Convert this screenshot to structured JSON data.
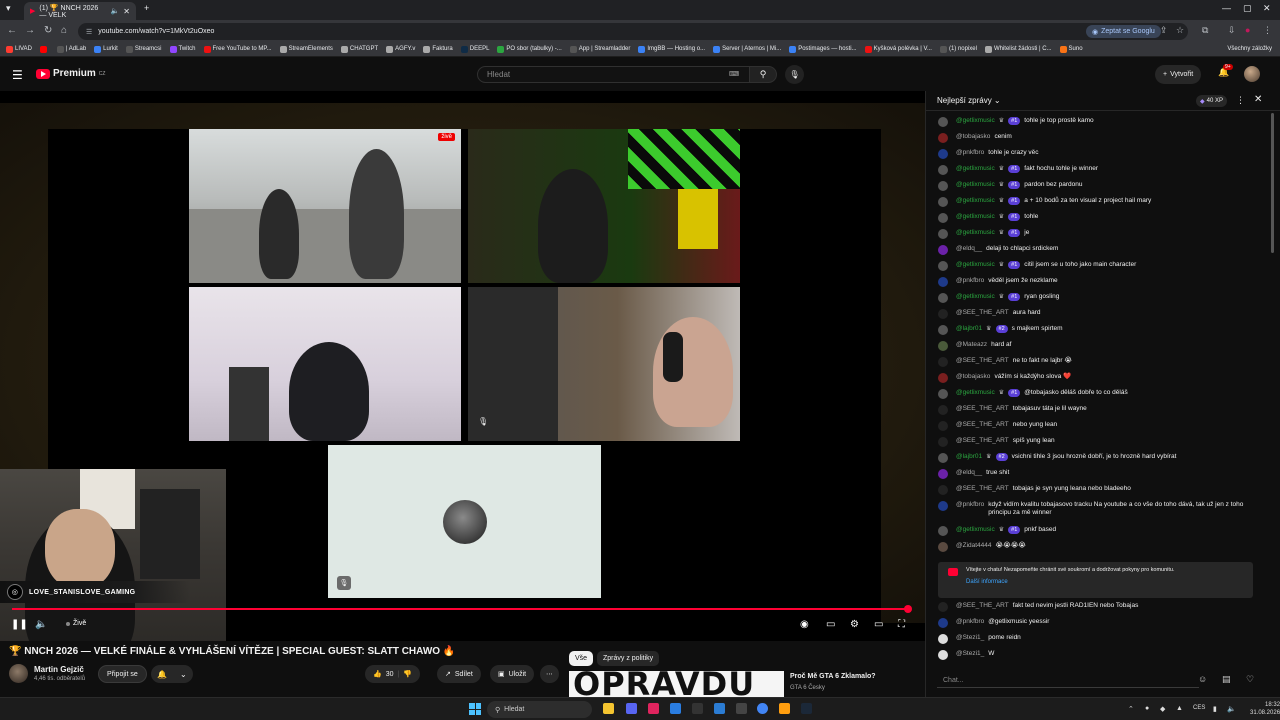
{
  "browser": {
    "tab_title": "(1) 🏆 NNCH 2026 — VELK",
    "url": "youtube.com/watch?v=1MkVt2uOxeo",
    "google_chip": "Zeptat se Googlu",
    "bookmarks": [
      {
        "label": "LIVAD",
        "color": "#ff3b30"
      },
      {
        "label": "",
        "color": "#ff0000"
      },
      {
        "label": "| AdLab",
        "color": "#555"
      },
      {
        "label": "Lurkit",
        "color": "#3b82f6"
      },
      {
        "label": "Streamcsi",
        "color": "#555"
      },
      {
        "label": "Twitch",
        "color": "#9146ff"
      },
      {
        "label": "Free YouTube to MP...",
        "color": "#e11"
      },
      {
        "label": "StreamElements",
        "color": "#aaa"
      },
      {
        "label": "CHATGPT",
        "color": "#aaa"
      },
      {
        "label": "AGFY.v",
        "color": "#aaa"
      },
      {
        "label": "Faktura",
        "color": "#aaa"
      },
      {
        "label": "DEEPL",
        "color": "#0f2b46"
      },
      {
        "label": "PO sbor (tabulky) -...",
        "color": "#2ba640"
      },
      {
        "label": "App | Streamladder",
        "color": "#555"
      },
      {
        "label": "ImgBB — Hosting o...",
        "color": "#3b82f6"
      },
      {
        "label": "Server | Aternos | Mi...",
        "color": "#3b82f6"
      },
      {
        "label": "Postimages — hosti...",
        "color": "#3b82f6"
      },
      {
        "label": "Kyšková polévka | V...",
        "color": "#e11"
      },
      {
        "label": "(1) nopixel",
        "color": "#555"
      },
      {
        "label": "Whitelist žádosti | C...",
        "color": "#aaa"
      },
      {
        "label": "Suno",
        "color": "#f97316"
      }
    ],
    "all_bookmarks": "Všechny záložky"
  },
  "youtube_header": {
    "brand": "Premium",
    "region": "CZ",
    "search_placeholder": "Hledat",
    "create_label": "Vytvořit",
    "notification_count": "9+"
  },
  "video": {
    "live_badge": "živě",
    "streamer_handle": "LOVE_STANISLOVE_GAMING",
    "live_label": "Živě",
    "progress": 0.99,
    "title": "🏆 NNCH 2026 — VELKÉ FINÁLE & VYHLÁŠENÍ VÍTĚZE | SPECIAL GUEST: SLATT CHAWO 🔥",
    "channel_name": "Martin Gejzič",
    "subscribers": "4,46 tis. odběratelů",
    "join_label": "Připojit se",
    "like_count": "30",
    "share_label": "Sdílet",
    "save_label": "Uložit"
  },
  "recommendations": {
    "filter_all": "Vše",
    "filter_news": "Zprávy z politiky",
    "thumb_text": "OPRAVDU AJ?",
    "title": "Proč Mě GTA 6 Zklamalo?",
    "channel": "GTA 6 Česky"
  },
  "chat": {
    "title": "Nejlepší zprávy",
    "xp": "40 XP",
    "input_placeholder": "Chat...",
    "notice_text": "Vítejte v chatu! Nezapomeňte chránit své soukromí a dodržovat pokyny pro komunitu.",
    "notice_link": "Další informace",
    "messages": [
      {
        "author": "@getlixmusic",
        "member": true,
        "badge": "#1",
        "text": "tohle je top prostě kamo",
        "color": "#555"
      },
      {
        "author": "@tobajasko",
        "member": false,
        "badge": "",
        "text": "cenim",
        "color": "#7a1f1f"
      },
      {
        "author": "@pnkfbro",
        "member": false,
        "badge": "",
        "text": "tohle je crazy věc",
        "color": "#1e3a8a"
      },
      {
        "author": "@getlixmusic",
        "member": true,
        "badge": "#1",
        "text": "fakt hochu tohle je winner",
        "color": "#555"
      },
      {
        "author": "@getlixmusic",
        "member": true,
        "badge": "#1",
        "text": "pardon bez pardonu",
        "color": "#555"
      },
      {
        "author": "@getlixmusic",
        "member": true,
        "badge": "#1",
        "text": "a + 10 bodů za ten visual z project hail mary",
        "color": "#555"
      },
      {
        "author": "@getlixmusic",
        "member": true,
        "badge": "#1",
        "text": "tohle",
        "color": "#555"
      },
      {
        "author": "@getlixmusic",
        "member": true,
        "badge": "#1",
        "text": "je",
        "color": "#555"
      },
      {
        "author": "@eldq__",
        "member": false,
        "badge": "",
        "text": "delaji to chlapci srdickem",
        "color": "#6b21a8"
      },
      {
        "author": "@getlixmusic",
        "member": true,
        "badge": "#1",
        "text": "citil jsem se u toho jako main character",
        "color": "#555"
      },
      {
        "author": "@pnkfbro",
        "member": false,
        "badge": "",
        "text": "věděl jsem že nezklame",
        "color": "#1e3a8a"
      },
      {
        "author": "@getlixmusic",
        "member": true,
        "badge": "#1",
        "text": "ryan gosling",
        "color": "#555"
      },
      {
        "author": "@SEE_THE_ART",
        "member": false,
        "badge": "",
        "text": "aura hard",
        "color": "#222"
      },
      {
        "author": "@lajbr01",
        "member": true,
        "badge": "#2",
        "text": "s majkem spirtem",
        "color": "#555"
      },
      {
        "author": "@Mateazz",
        "member": false,
        "badge": "",
        "text": "hard af",
        "color": "#4a5a3a"
      },
      {
        "author": "@SEE_THE_ART",
        "member": false,
        "badge": "",
        "text": "ne to fakt ne lajbr 😭",
        "color": "#222"
      },
      {
        "author": "@tobajasko",
        "member": false,
        "badge": "",
        "text": "vážím si každýho slova ❤️",
        "color": "#7a1f1f"
      },
      {
        "author": "@getlixmusic",
        "member": true,
        "badge": "#1",
        "text": "@tobajasko děláš dobře to co děláš",
        "color": "#555"
      },
      {
        "author": "@SEE_THE_ART",
        "member": false,
        "badge": "",
        "text": "tobajasuv táta je lil wayne",
        "color": "#222"
      },
      {
        "author": "@SEE_THE_ART",
        "member": false,
        "badge": "",
        "text": "nebo yung lean",
        "color": "#222"
      },
      {
        "author": "@SEE_THE_ART",
        "member": false,
        "badge": "",
        "text": "spíš yung lean",
        "color": "#222"
      },
      {
        "author": "@lajbr01",
        "member": true,
        "badge": "#2",
        "text": "vsichni tihle 3 jsou hrozně dobří, je to hrozně hard vybírat",
        "color": "#555"
      },
      {
        "author": "@eldq__",
        "member": false,
        "badge": "",
        "text": "true shit",
        "color": "#6b21a8"
      },
      {
        "author": "@SEE_THE_ART",
        "member": false,
        "badge": "",
        "text": "tobajas je syn yung leana nebo bladeeho",
        "color": "#222"
      },
      {
        "author": "@pnkfbro",
        "member": false,
        "badge": "",
        "text": "když vidím kvalitu tobajasovo tracku Na youtube a co vše do toho dává, tak už jen z toho principu za mě winner",
        "color": "#1e3a8a"
      },
      {
        "author": "@getlixmusic",
        "member": true,
        "badge": "#1",
        "text": "pnkf based",
        "color": "#555"
      },
      {
        "author": "@Zidat4444",
        "member": false,
        "badge": "",
        "text": "😭😭😭😭",
        "color": "#5a4a40"
      },
      {
        "author": "@SEE_THE_ART",
        "member": false,
        "badge": "",
        "text": "fakt ted nevim jestli RAD1IEN nebo Tobajas",
        "color": "#222"
      },
      {
        "author": "@pnkfbro",
        "member": false,
        "badge": "",
        "text": "@getlixmusic yeessir",
        "color": "#1e3a8a"
      },
      {
        "author": "@Stezi1_",
        "member": false,
        "badge": "",
        "text": "pome reidn",
        "color": "#ddd"
      },
      {
        "author": "@Stezi1_",
        "member": false,
        "badge": "",
        "text": "W",
        "color": "#ddd"
      }
    ]
  },
  "taskbar": {
    "search": "Hledat",
    "lang": "CES",
    "time": "18:32",
    "date": "31.08.2026"
  }
}
